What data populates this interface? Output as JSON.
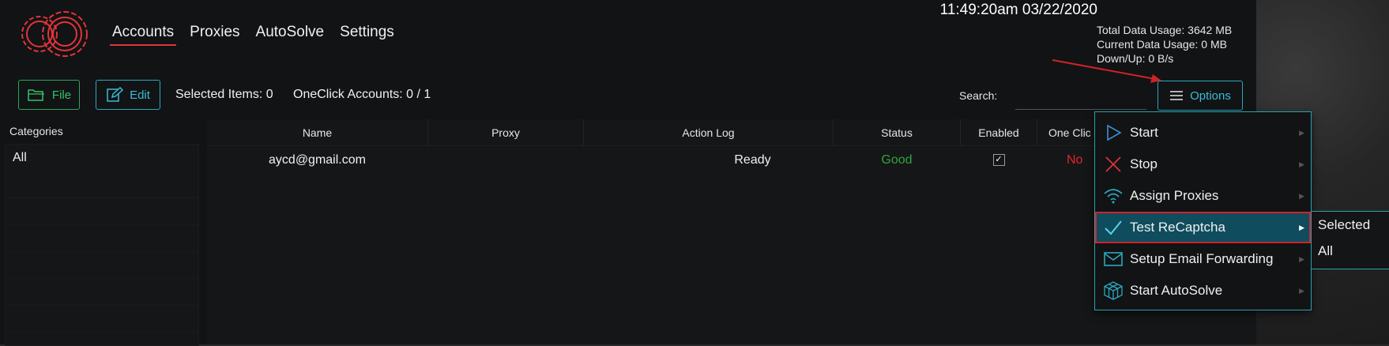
{
  "nav": {
    "items": [
      {
        "label": "Accounts",
        "active": true
      },
      {
        "label": "Proxies",
        "active": false
      },
      {
        "label": "AutoSolve",
        "active": false
      },
      {
        "label": "Settings",
        "active": false
      }
    ]
  },
  "status": {
    "datetime": "11:49:20am 03/22/2020",
    "total_data_usage": "Total Data Usage:  3642 MB",
    "current_data_usage": "Current Data Usage: 0 MB",
    "down_up": "Down/Up: 0 B/s"
  },
  "toolbar": {
    "file_label": "File",
    "edit_label": "Edit",
    "selected_items": "Selected Items: 0",
    "oneclick_accounts": "OneClick Accounts: 0 / 1",
    "search_label": "Search:",
    "search_value": "",
    "options_label": "Options"
  },
  "categories": {
    "title": "Categories",
    "items": [
      "All"
    ]
  },
  "table": {
    "columns": [
      "Name",
      "Proxy",
      "Action Log",
      "Status",
      "Enabled",
      "One Clic"
    ],
    "rows": [
      {
        "name": "aycd@gmail.com",
        "proxy": "",
        "action_log": "Ready",
        "status": "Good",
        "enabled": "✓",
        "one_click": "No"
      }
    ]
  },
  "options_menu": {
    "items": [
      {
        "label": "Start",
        "icon": "play-icon"
      },
      {
        "label": "Stop",
        "icon": "x-icon"
      },
      {
        "label": "Assign Proxies",
        "icon": "wifi-icon"
      },
      {
        "label": "Test ReCaptcha",
        "icon": "check-icon",
        "active": true
      },
      {
        "label": "Setup Email Forwarding",
        "icon": "envelope-icon"
      },
      {
        "label": "Start AutoSolve",
        "icon": "cube-icon"
      }
    ],
    "submenu": [
      "Selected",
      "All"
    ]
  },
  "colors": {
    "accent_red": "#e0353b",
    "accent_teal": "#2aa9c0",
    "green": "#35c36a",
    "status_good": "#2fa341",
    "status_no": "#e0262b",
    "menu_active_bg": "#0f4d5e"
  }
}
